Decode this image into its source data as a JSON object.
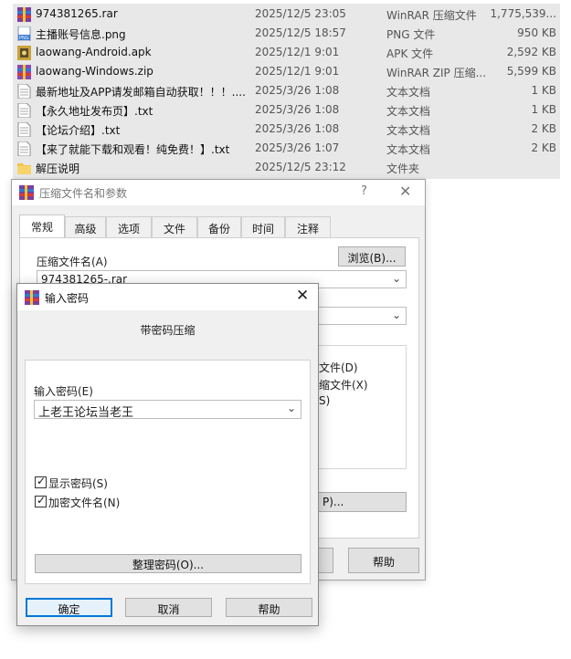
{
  "files": [
    {
      "name": "974381265.rar",
      "date": "2025/12/5 23:05",
      "type": "WinRAR 压缩文件",
      "size": "1,775,539...",
      "icon": "rar-icon"
    },
    {
      "name": "主播账号信息.png",
      "date": "2025/12/5 18:57",
      "type": "PNG 文件",
      "size": "950 KB",
      "icon": "png-icon"
    },
    {
      "name": "laowang-Android.apk",
      "date": "2025/12/1 9:01",
      "type": "APK 文件",
      "size": "2,592 KB",
      "icon": "apk-icon"
    },
    {
      "name": "laowang-Windows.zip",
      "date": "2025/12/1 9:01",
      "type": "WinRAR ZIP 压缩...",
      "size": "5,599 KB",
      "icon": "zip-icon"
    },
    {
      "name": "最新地址及APP请发邮箱自动获取！！！....",
      "date": "2025/3/26 1:08",
      "type": "文本文档",
      "size": "1 KB",
      "icon": "txt-icon"
    },
    {
      "name": "【永久地址发布页】.txt",
      "date": "2025/3/26 1:08",
      "type": "文本文档",
      "size": "1 KB",
      "icon": "txt-icon"
    },
    {
      "name": "【论坛介绍】.txt",
      "date": "2025/3/26 1:08",
      "type": "文本文档",
      "size": "2 KB",
      "icon": "txt-icon"
    },
    {
      "name": "【来了就能下载和观看！纯免费！】.txt",
      "date": "2025/3/26 1:07",
      "type": "文本文档",
      "size": "2 KB",
      "icon": "txt-icon"
    },
    {
      "name": "解压说明",
      "date": "2025/12/5 23:12",
      "type": "文件夹",
      "size": "",
      "icon": "folder-icon"
    }
  ],
  "archive_dialog": {
    "title": "压缩文件名和参数",
    "help": "?",
    "close": "✕",
    "tabs": [
      "常规",
      "高级",
      "选项",
      "文件",
      "备份",
      "时间",
      "注释"
    ],
    "archive_name_label": "压缩文件名(A)",
    "browse_button": "浏览(B)...",
    "archive_name_value": "974381265-.rar",
    "option_fragments": [
      "文件(D)",
      "缩文件(X)",
      "S)"
    ],
    "set_password_fragment": "P)...",
    "help_button": "帮助"
  },
  "password_dialog": {
    "title": "输入密码",
    "close": "✕",
    "heading": "带密码压缩",
    "enter_password_label": "输入密码(E)",
    "password_value": "上老王论坛当老王",
    "show_password_label": "显示密码(S)",
    "show_password_checked": true,
    "encrypt_names_label": "加密文件名(N)",
    "encrypt_names_checked": true,
    "organize_button": "整理密码(O)...",
    "ok_button": "确定",
    "cancel_button": "取消",
    "help_button": "帮助"
  },
  "colors": {
    "accent": "#0078d7",
    "filelist_bg": "#e8e8e8",
    "dialog_bg": "#f0f0f0"
  }
}
